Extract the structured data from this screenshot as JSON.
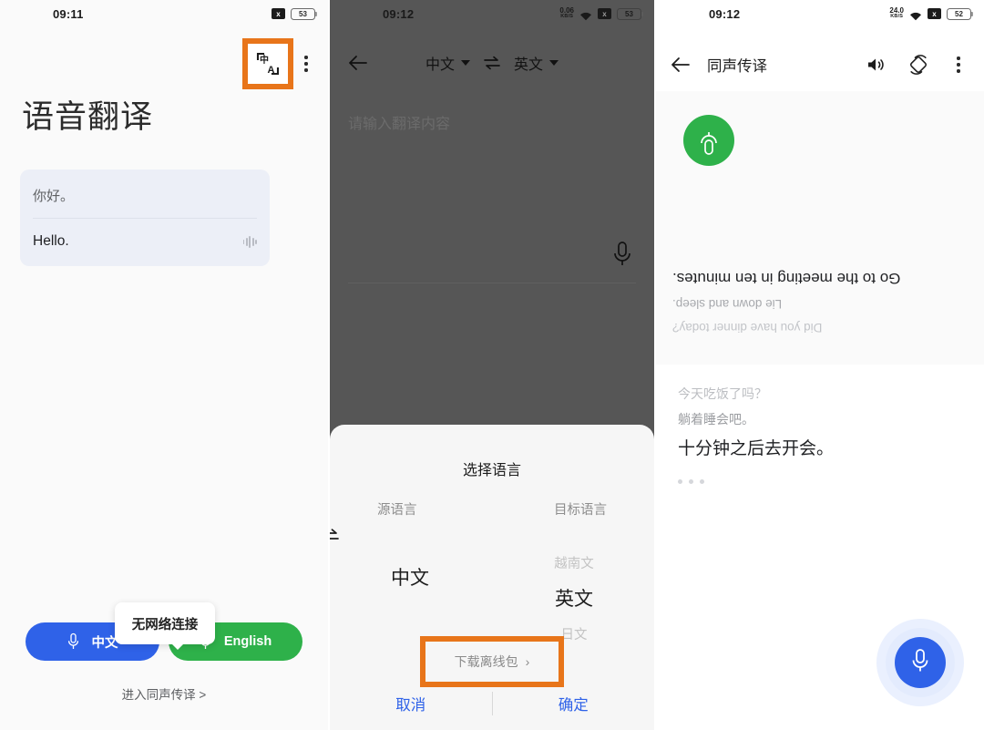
{
  "panels": {
    "p1": {
      "status": {
        "time": "09:11",
        "battery": "53",
        "x_badge": "x"
      },
      "translate_icon_name": "translate-icon",
      "title": "语音翻译",
      "result": {
        "source": "你好。",
        "target": "Hello."
      },
      "buttons": {
        "left": "中文",
        "right": "English"
      },
      "tooltip": "无网络连接",
      "link": "进入同声传译 >"
    },
    "p2": {
      "status": {
        "time": "09:12",
        "battery": "53",
        "speed_value": "0.06",
        "speed_unit": "KB/S",
        "x_badge": "x"
      },
      "source_lang": "中文",
      "target_lang": "英文",
      "input_placeholder": "请输入翻译内容",
      "sheet": {
        "title": "选择语言",
        "col_source": "源语言",
        "col_target": "目标语言",
        "source_selected": "中文",
        "target_selected": "英文",
        "target_above": "越南文",
        "target_below": "日文",
        "download": "下载离线包",
        "download_chevron": "›",
        "cancel": "取消",
        "confirm": "确定"
      }
    },
    "p3": {
      "status": {
        "time": "09:12",
        "battery": "52",
        "speed_value": "24.0",
        "speed_unit": "KB/S",
        "x_badge": "x"
      },
      "title": "同声传译",
      "remote": {
        "line1": "Go to the meeting in ten minutes.",
        "line2": "Lie down and sleep.",
        "line3": "Did you have dinner today?"
      },
      "local": {
        "line1": "今天吃饭了吗？",
        "line2": "躺着睡会吧。",
        "line3": "十分钟之后去开会。"
      }
    }
  },
  "colors": {
    "highlight": "#e8751a",
    "blue": "#2f62e8",
    "green": "#2eb14a",
    "dim_overlay": "#8f8f8f"
  }
}
